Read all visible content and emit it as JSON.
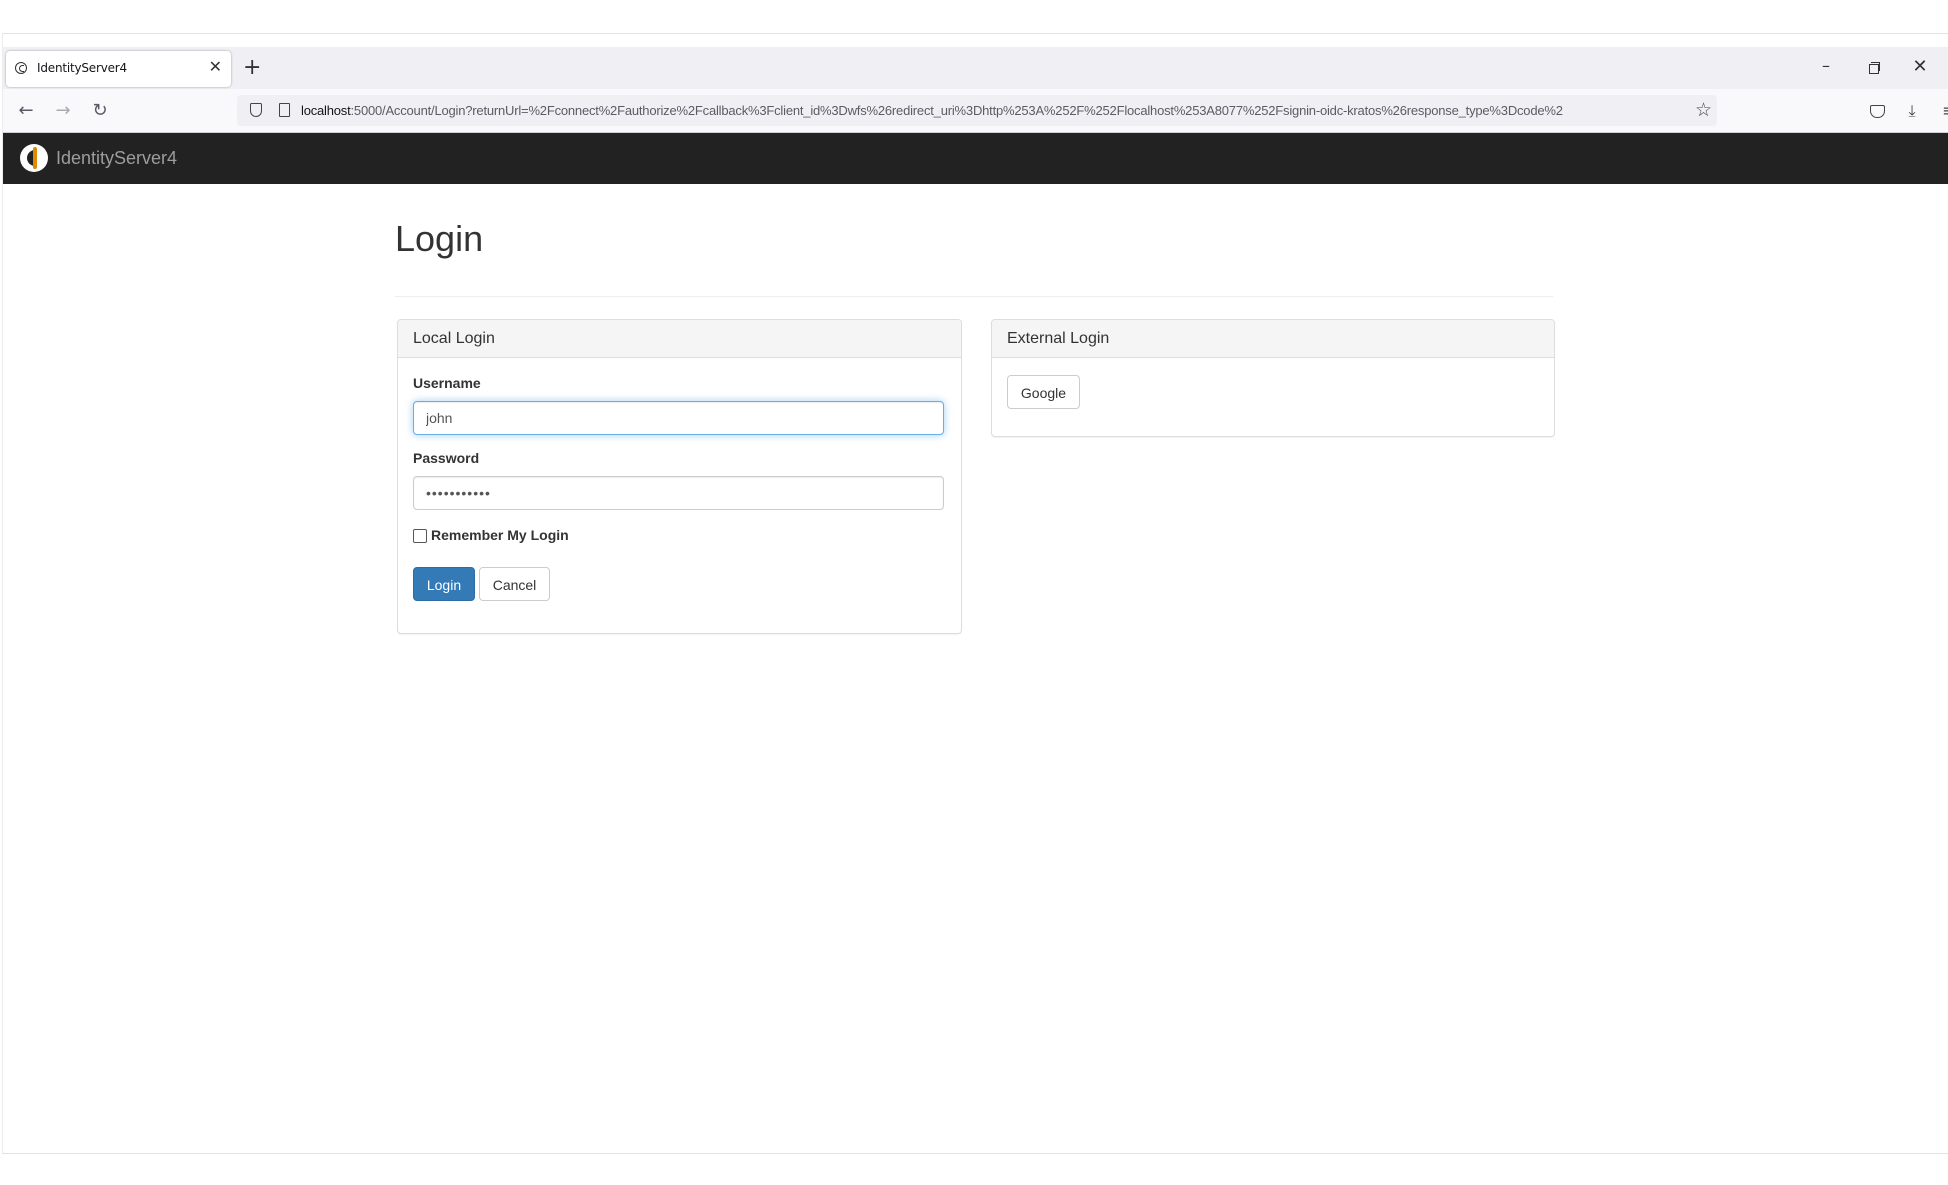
{
  "browser": {
    "tab_title": "IdentityServer4",
    "url_host": "localhost",
    "url_rest": ":5000/Account/Login?returnUrl=%2Fconnect%2Fauthorize%2Fcallback%3Fclient_id%3Dwfs%26redirect_uri%3Dhttp%253A%252F%252Flocalhost%253A8077%252Fsignin-oidc-kratos%26response_type%3Dcode%2"
  },
  "app": {
    "brand": "IdentityServer4"
  },
  "page": {
    "title": "Login"
  },
  "local_login": {
    "heading": "Local Login",
    "username_label": "Username",
    "username_value": "john",
    "password_label": "Password",
    "password_value": "•••••••••••",
    "remember_label": "Remember My Login",
    "remember_checked": false,
    "login_button": "Login",
    "cancel_button": "Cancel"
  },
  "external_login": {
    "heading": "External Login",
    "providers": [
      "Google"
    ]
  },
  "colors": {
    "navbar_bg": "#222222",
    "primary": "#337ab7",
    "focus_border": "#66afe9"
  }
}
